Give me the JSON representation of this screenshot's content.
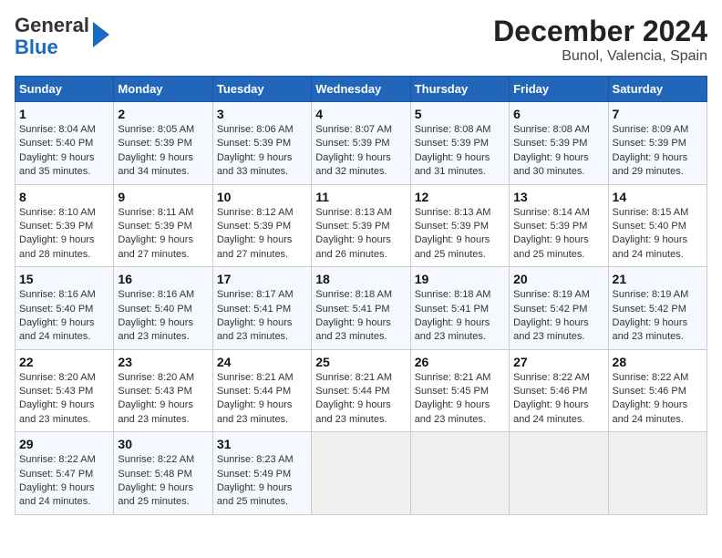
{
  "header": {
    "logo_line1": "General",
    "logo_line2": "Blue",
    "title": "December 2024",
    "subtitle": "Bunol, Valencia, Spain"
  },
  "weekdays": [
    "Sunday",
    "Monday",
    "Tuesday",
    "Wednesday",
    "Thursday",
    "Friday",
    "Saturday"
  ],
  "weeks": [
    [
      {
        "day": 1,
        "sunrise": "8:04 AM",
        "sunset": "5:40 PM",
        "daylight": "9 hours and 35 minutes."
      },
      {
        "day": 2,
        "sunrise": "8:05 AM",
        "sunset": "5:39 PM",
        "daylight": "9 hours and 34 minutes."
      },
      {
        "day": 3,
        "sunrise": "8:06 AM",
        "sunset": "5:39 PM",
        "daylight": "9 hours and 33 minutes."
      },
      {
        "day": 4,
        "sunrise": "8:07 AM",
        "sunset": "5:39 PM",
        "daylight": "9 hours and 32 minutes."
      },
      {
        "day": 5,
        "sunrise": "8:08 AM",
        "sunset": "5:39 PM",
        "daylight": "9 hours and 31 minutes."
      },
      {
        "day": 6,
        "sunrise": "8:08 AM",
        "sunset": "5:39 PM",
        "daylight": "9 hours and 30 minutes."
      },
      {
        "day": 7,
        "sunrise": "8:09 AM",
        "sunset": "5:39 PM",
        "daylight": "9 hours and 29 minutes."
      }
    ],
    [
      {
        "day": 8,
        "sunrise": "8:10 AM",
        "sunset": "5:39 PM",
        "daylight": "9 hours and 28 minutes."
      },
      {
        "day": 9,
        "sunrise": "8:11 AM",
        "sunset": "5:39 PM",
        "daylight": "9 hours and 27 minutes."
      },
      {
        "day": 10,
        "sunrise": "8:12 AM",
        "sunset": "5:39 PM",
        "daylight": "9 hours and 27 minutes."
      },
      {
        "day": 11,
        "sunrise": "8:13 AM",
        "sunset": "5:39 PM",
        "daylight": "9 hours and 26 minutes."
      },
      {
        "day": 12,
        "sunrise": "8:13 AM",
        "sunset": "5:39 PM",
        "daylight": "9 hours and 25 minutes."
      },
      {
        "day": 13,
        "sunrise": "8:14 AM",
        "sunset": "5:39 PM",
        "daylight": "9 hours and 25 minutes."
      },
      {
        "day": 14,
        "sunrise": "8:15 AM",
        "sunset": "5:40 PM",
        "daylight": "9 hours and 24 minutes."
      }
    ],
    [
      {
        "day": 15,
        "sunrise": "8:16 AM",
        "sunset": "5:40 PM",
        "daylight": "9 hours and 24 minutes."
      },
      {
        "day": 16,
        "sunrise": "8:16 AM",
        "sunset": "5:40 PM",
        "daylight": "9 hours and 23 minutes."
      },
      {
        "day": 17,
        "sunrise": "8:17 AM",
        "sunset": "5:41 PM",
        "daylight": "9 hours and 23 minutes."
      },
      {
        "day": 18,
        "sunrise": "8:18 AM",
        "sunset": "5:41 PM",
        "daylight": "9 hours and 23 minutes."
      },
      {
        "day": 19,
        "sunrise": "8:18 AM",
        "sunset": "5:41 PM",
        "daylight": "9 hours and 23 minutes."
      },
      {
        "day": 20,
        "sunrise": "8:19 AM",
        "sunset": "5:42 PM",
        "daylight": "9 hours and 23 minutes."
      },
      {
        "day": 21,
        "sunrise": "8:19 AM",
        "sunset": "5:42 PM",
        "daylight": "9 hours and 23 minutes."
      }
    ],
    [
      {
        "day": 22,
        "sunrise": "8:20 AM",
        "sunset": "5:43 PM",
        "daylight": "9 hours and 23 minutes."
      },
      {
        "day": 23,
        "sunrise": "8:20 AM",
        "sunset": "5:43 PM",
        "daylight": "9 hours and 23 minutes."
      },
      {
        "day": 24,
        "sunrise": "8:21 AM",
        "sunset": "5:44 PM",
        "daylight": "9 hours and 23 minutes."
      },
      {
        "day": 25,
        "sunrise": "8:21 AM",
        "sunset": "5:44 PM",
        "daylight": "9 hours and 23 minutes."
      },
      {
        "day": 26,
        "sunrise": "8:21 AM",
        "sunset": "5:45 PM",
        "daylight": "9 hours and 23 minutes."
      },
      {
        "day": 27,
        "sunrise": "8:22 AM",
        "sunset": "5:46 PM",
        "daylight": "9 hours and 24 minutes."
      },
      {
        "day": 28,
        "sunrise": "8:22 AM",
        "sunset": "5:46 PM",
        "daylight": "9 hours and 24 minutes."
      }
    ],
    [
      {
        "day": 29,
        "sunrise": "8:22 AM",
        "sunset": "5:47 PM",
        "daylight": "9 hours and 24 minutes."
      },
      {
        "day": 30,
        "sunrise": "8:22 AM",
        "sunset": "5:48 PM",
        "daylight": "9 hours and 25 minutes."
      },
      {
        "day": 31,
        "sunrise": "8:23 AM",
        "sunset": "5:49 PM",
        "daylight": "9 hours and 25 minutes."
      },
      null,
      null,
      null,
      null
    ]
  ]
}
